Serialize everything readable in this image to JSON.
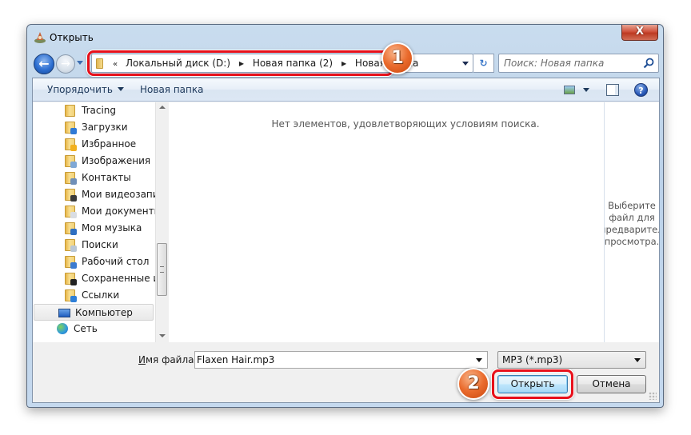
{
  "window": {
    "title": "Открыть",
    "close_label": "X"
  },
  "nav": {
    "back_glyph": "←",
    "forward_glyph": "→",
    "refresh_glyph": "↻"
  },
  "address": {
    "overflow_glyph": "«",
    "separator_glyph": "▶",
    "crumbs": [
      "Локальный диск (D:)",
      "Новая папка (2)",
      "Новая папка"
    ]
  },
  "search": {
    "placeholder": "Поиск: Новая папка"
  },
  "toolbar": {
    "organize_label": "Упорядочить",
    "new_folder_label": "Новая папка",
    "help_glyph": "?"
  },
  "sidebar": {
    "items": [
      {
        "label": "Tracing",
        "icon": "folder-icon",
        "level": "sub"
      },
      {
        "label": "Загрузки",
        "icon": "downloads-folder-icon",
        "level": "sub"
      },
      {
        "label": "Избранное",
        "icon": "favorites-folder-icon",
        "level": "sub"
      },
      {
        "label": "Изображения",
        "icon": "pictures-folder-icon",
        "level": "sub"
      },
      {
        "label": "Контакты",
        "icon": "contacts-folder-icon",
        "level": "sub"
      },
      {
        "label": "Мои видеозаписи",
        "icon": "videos-folder-icon",
        "level": "sub"
      },
      {
        "label": "Мои документы",
        "icon": "documents-folder-icon",
        "level": "sub"
      },
      {
        "label": "Моя музыка",
        "icon": "music-folder-icon",
        "level": "sub"
      },
      {
        "label": "Поиски",
        "icon": "searches-folder-icon",
        "level": "sub"
      },
      {
        "label": "Рабочий стол",
        "icon": "desktop-folder-icon",
        "level": "sub"
      },
      {
        "label": "Сохраненные игры",
        "icon": "saved-games-folder-icon",
        "level": "sub"
      },
      {
        "label": "Ссылки",
        "icon": "links-folder-icon",
        "level": "sub"
      },
      {
        "label": "Компьютер",
        "icon": "computer-icon",
        "level": "top",
        "selected": true
      },
      {
        "label": "Сеть",
        "icon": "network-icon",
        "level": "top"
      }
    ]
  },
  "file_list": {
    "empty_message": "Нет элементов, удовлетворяющих условиям поиска."
  },
  "preview": {
    "message_lines": [
      "Выберите",
      "файл для",
      "предварительного",
      "просмотра."
    ]
  },
  "bottom": {
    "filename_label_accel": "И",
    "filename_label_rest": "мя файла:",
    "filename_value": "Flaxen Hair.mp3",
    "filetype_value": "MP3 (*.mp3)",
    "open_label": "Открыть",
    "cancel_label": "Отмена"
  },
  "annotations": {
    "step1": "1",
    "step2": "2",
    "highlight_color": "#e8101a",
    "badge_color": "#ea6b2d"
  }
}
